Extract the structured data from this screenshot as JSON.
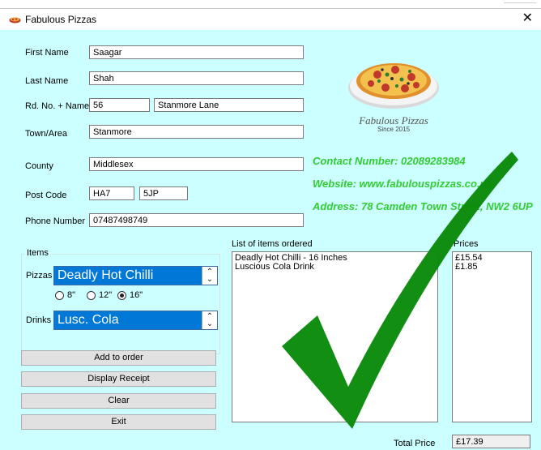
{
  "window": {
    "title": "Fabulous Pizzas",
    "close_glyph": "✕",
    "icon": "pizza-app-icon"
  },
  "form": {
    "first_name": {
      "label": "First Name",
      "value": "Saagar"
    },
    "last_name": {
      "label": "Last Name",
      "value": "Shah"
    },
    "road": {
      "label": "Rd. No. + Name",
      "number": "56",
      "name": "Stanmore Lane"
    },
    "town": {
      "label": "Town/Area",
      "value": "Stanmore"
    },
    "county": {
      "label": "County",
      "value": "Middlesex"
    },
    "post_code": {
      "label": "Post Code",
      "part1": "HA7",
      "part2": "5JP"
    },
    "phone": {
      "label": "Phone Number",
      "value": "07487498749"
    }
  },
  "info": {
    "contact": "Contact Number: 02089283984",
    "website": "Website: www.fabulouspizzas.co.uk",
    "address": "Address: 78 Camden Town Street, NW2 6UP"
  },
  "logo": {
    "brand": "Fabulous Pizzas",
    "since": "Since 2015"
  },
  "items": {
    "title": "Items",
    "pizzas_label": "Pizzas",
    "pizza_selected": "Deadly Hot Chilli",
    "sizes": [
      {
        "label": "8\"",
        "checked": false
      },
      {
        "label": "12\"",
        "checked": false
      },
      {
        "label": "16\"",
        "checked": true
      }
    ],
    "drinks_label": "Drinks",
    "drink_selected": "Lusc. Cola"
  },
  "buttons": {
    "add": "Add to order",
    "receipt": "Display Receipt",
    "clear": "Clear",
    "exit": "Exit"
  },
  "order": {
    "list_title": "List of items ordered",
    "items": [
      "Deadly Hot Chilli - 16 Inches",
      "Luscious Cola Drink"
    ],
    "prices_title": "Prices",
    "prices": [
      "£15.54",
      "£1.85"
    ],
    "total_label": "Total Price",
    "total_value": "£17.39"
  },
  "colors": {
    "client_bg": "#ccffff",
    "info_text": "#33cc33",
    "checkmark": "#0a8a0a",
    "combo_bg": "#0078d7"
  }
}
